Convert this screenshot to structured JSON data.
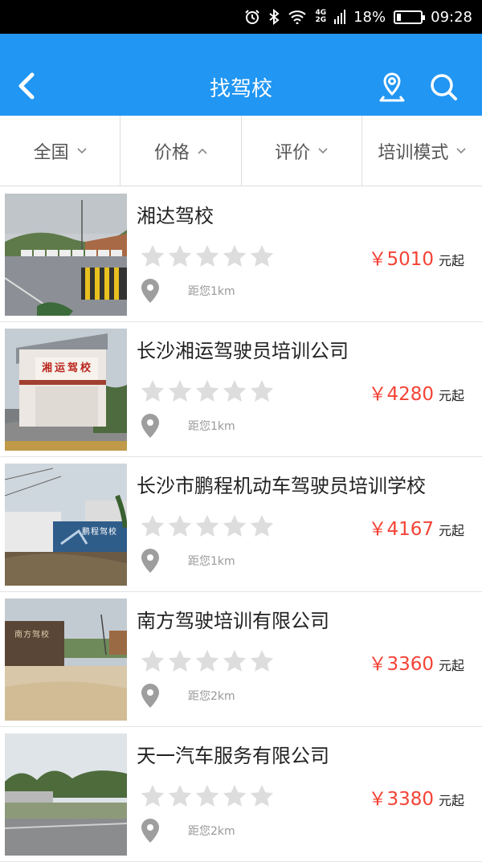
{
  "status_bar": {
    "network": "4G",
    "network2": "2G",
    "battery_percent": "18%",
    "battery_level": 0.18,
    "time": "09:28"
  },
  "nav": {
    "title": "找驾校",
    "back_icon": "chevron-left-icon",
    "location_icon": "map-pin-icon",
    "search_icon": "search-icon"
  },
  "filters": [
    {
      "label": "全国",
      "state": "collapsed"
    },
    {
      "label": "价格",
      "state": "expanded"
    },
    {
      "label": "评价",
      "state": "collapsed"
    },
    {
      "label": "培训模式",
      "state": "collapsed"
    }
  ],
  "schools": [
    {
      "name": "湘达驾校",
      "rating": 0,
      "price": "￥5010",
      "price_suffix": "元起",
      "distance": "距您1km",
      "photo": "lot"
    },
    {
      "name": "长沙湘运驾驶员培训公司",
      "rating": 0,
      "price": "￥4280",
      "price_suffix": "元起",
      "distance": "距您1km",
      "photo": "tower",
      "photo_sign": "湘运驾校"
    },
    {
      "name": "长沙市鹏程机动车驾驶员培训学校",
      "rating": 0,
      "price": "￥4167",
      "price_suffix": "元起",
      "distance": "距您1km",
      "photo": "gate",
      "photo_sign": "鹏程驾校"
    },
    {
      "name": "南方驾驶培训有限公司",
      "rating": 0,
      "price": "￥3360",
      "price_suffix": "元起",
      "distance": "距您2km",
      "photo": "shed",
      "photo_sign": "南方驾校"
    },
    {
      "name": "天一汽车服务有限公司",
      "rating": 0,
      "price": "￥3380",
      "price_suffix": "元起",
      "distance": "距您2km",
      "photo": "field"
    }
  ],
  "colors": {
    "primary": "#2196f3",
    "price": "#f44336",
    "star_empty": "#dddddd"
  }
}
